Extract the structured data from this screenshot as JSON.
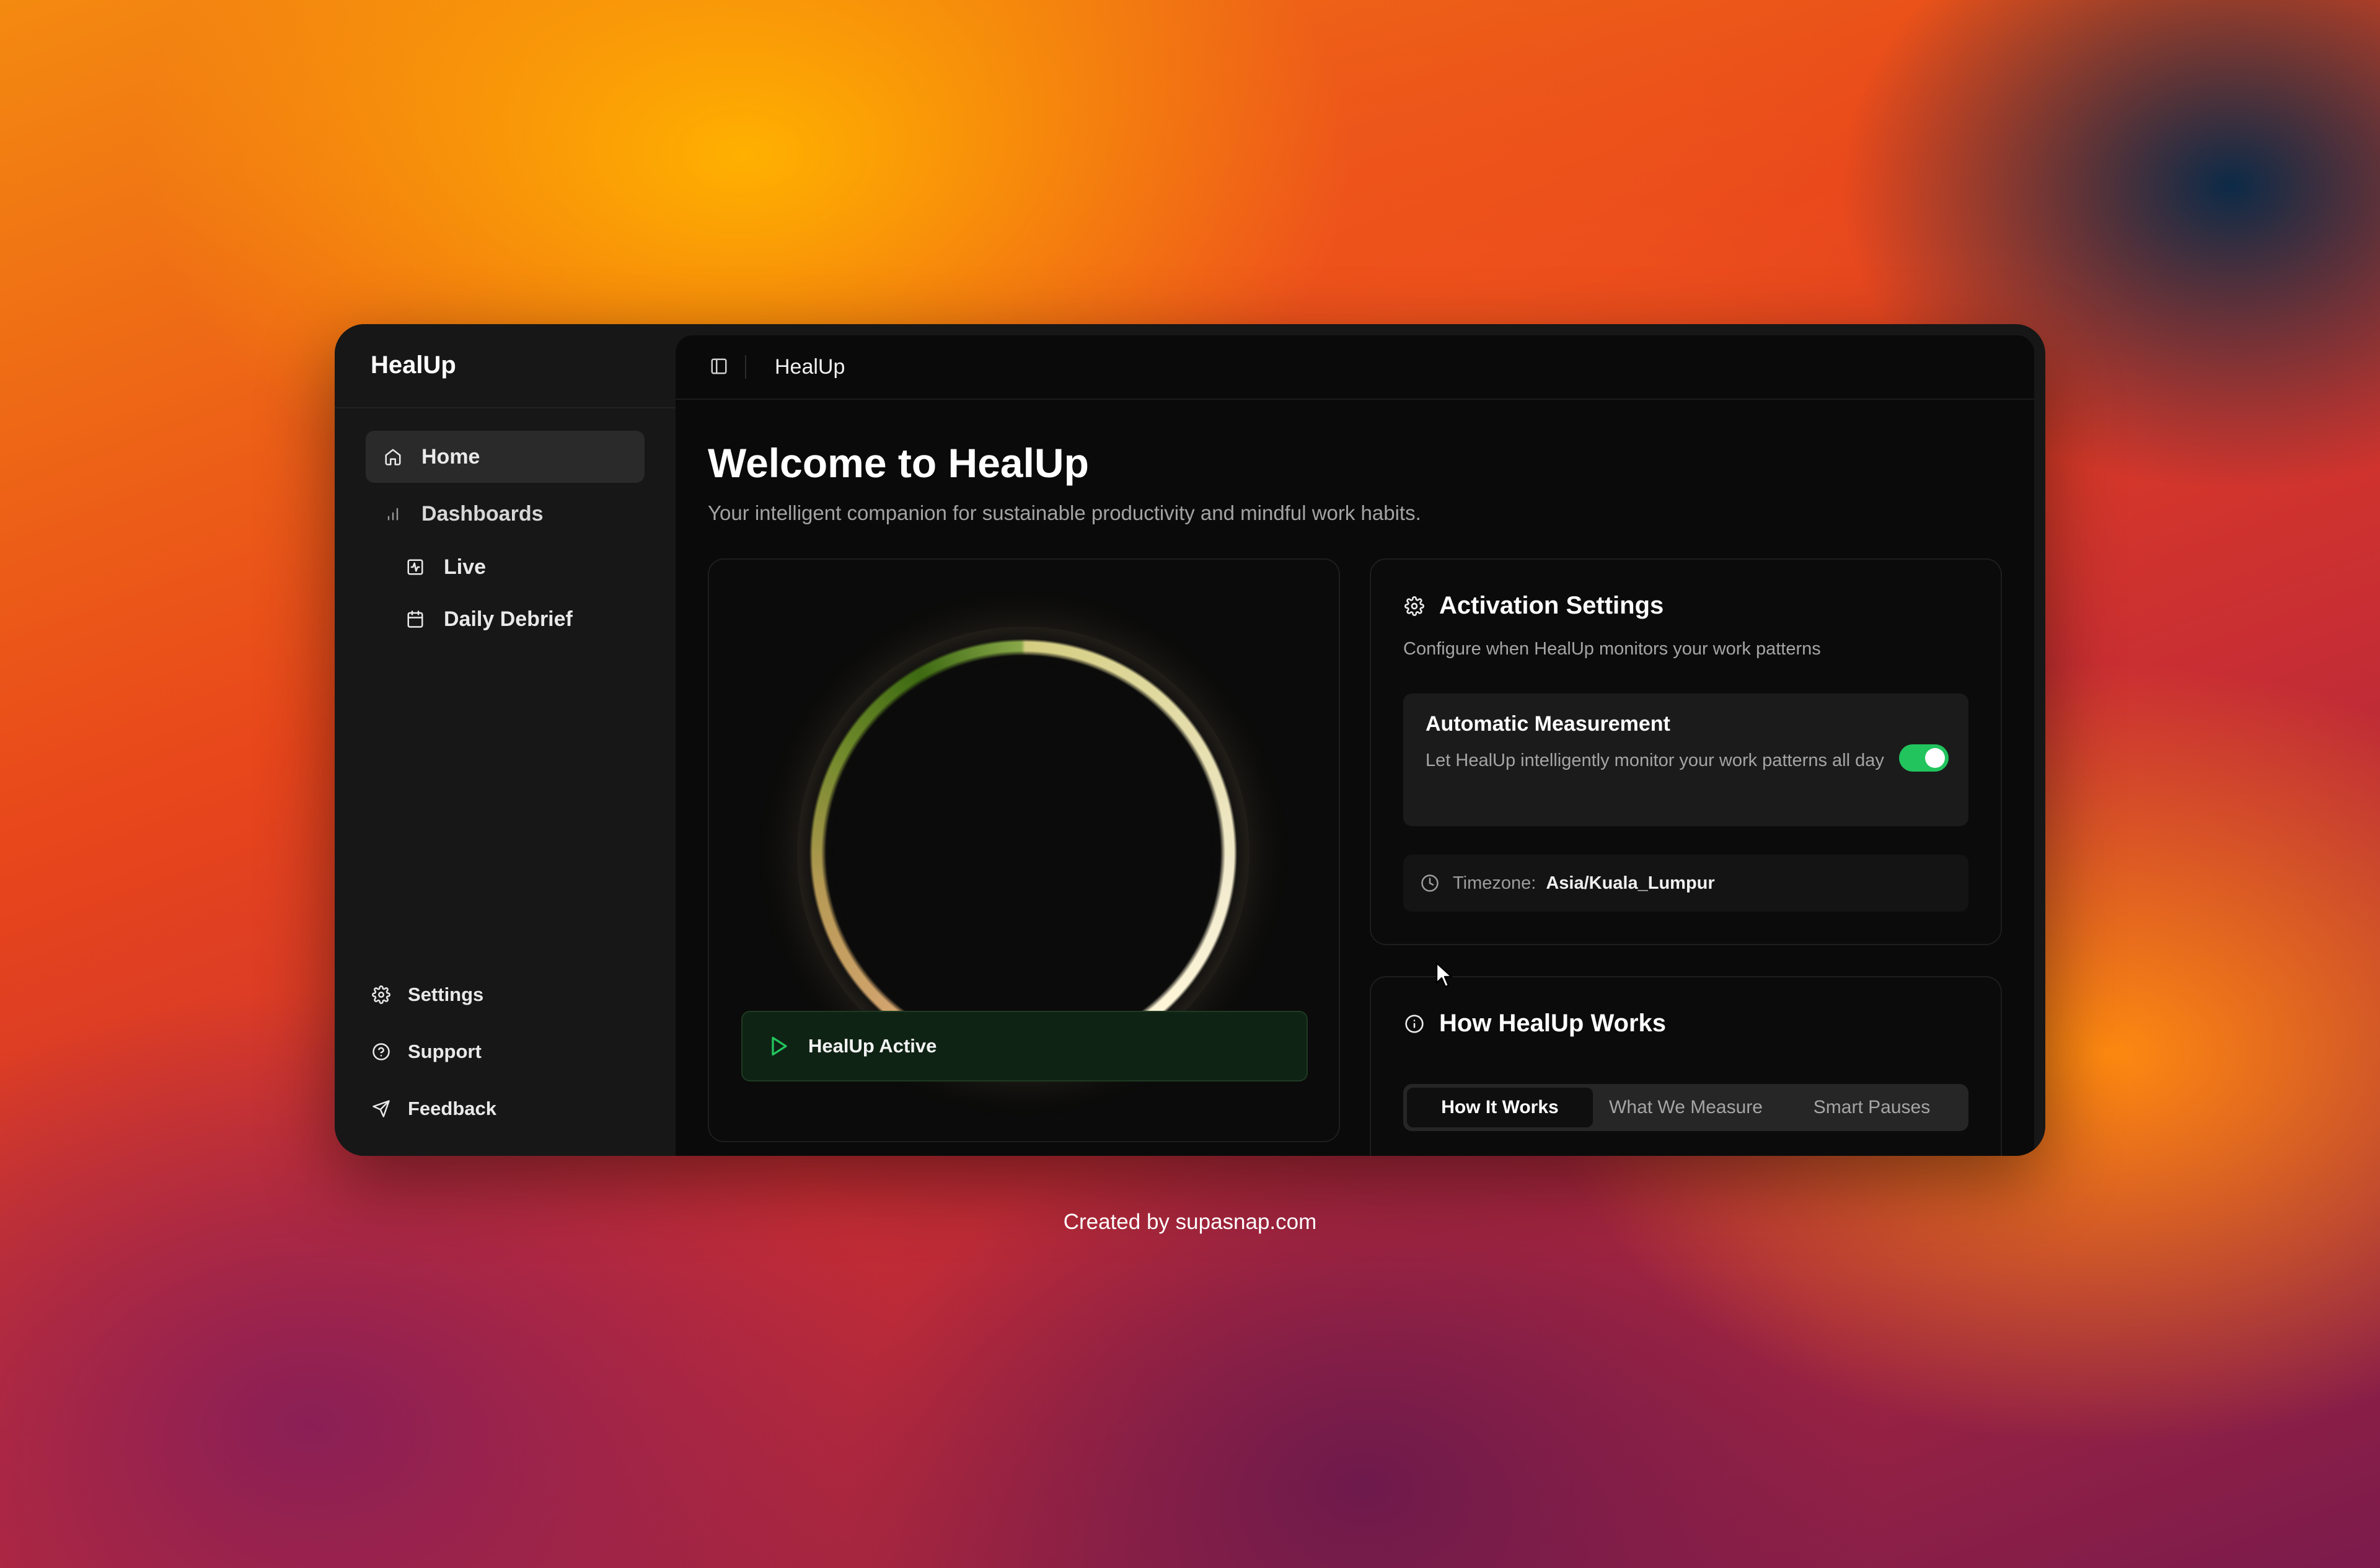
{
  "sidebar": {
    "brand": "HealUp",
    "nav": [
      {
        "label": "Home",
        "icon": "home-icon"
      },
      {
        "label": "Dashboards",
        "icon": "bar-chart-icon"
      },
      {
        "label": "Live",
        "icon": "activity-square-icon"
      },
      {
        "label": "Daily Debrief",
        "icon": "calendar-icon"
      }
    ],
    "bottom": [
      {
        "label": "Settings",
        "icon": "gear-icon"
      },
      {
        "label": "Support",
        "icon": "help-circle-icon"
      },
      {
        "label": "Feedback",
        "icon": "send-icon"
      }
    ]
  },
  "topbar": {
    "title": "HealUp"
  },
  "page": {
    "title": "Welcome to HealUp",
    "subtitle": "Your intelligent companion for sustainable productivity and mindful work habits."
  },
  "status": {
    "label": "HealUp Active"
  },
  "activation": {
    "title": "Activation Settings",
    "description": "Configure when HealUp monitors your work patterns",
    "auto_title": "Automatic Measurement",
    "auto_desc": "Let HealUp intelligently monitor your work patterns all day",
    "auto_enabled": true,
    "timezone_label": "Timezone:",
    "timezone_value": "Asia/Kuala_Lumpur"
  },
  "how": {
    "title": "How HealUp Works",
    "tabs": [
      "How It Works",
      "What We Measure",
      "Smart Pauses"
    ],
    "active_tab": "How It Works"
  },
  "colors": {
    "accent_green": "#21c45d"
  },
  "credit": "Created by supasnap.com"
}
